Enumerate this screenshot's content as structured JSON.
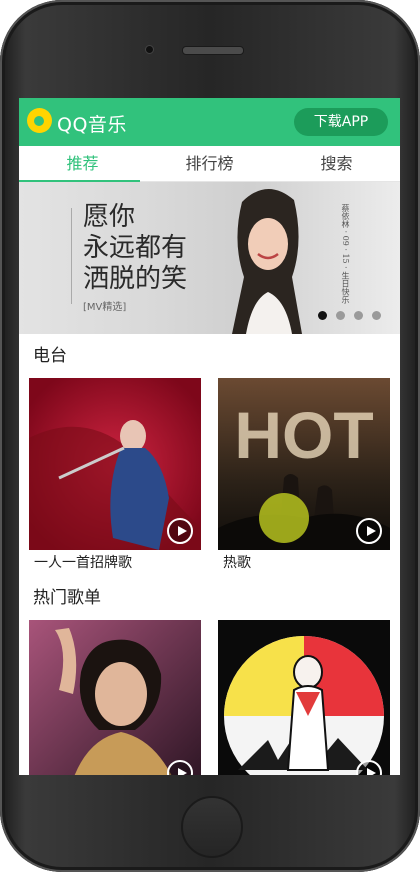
{
  "app": {
    "brand": "QQ音乐",
    "download_label": "下载APP"
  },
  "tabs": [
    {
      "label": "推荐",
      "active": true
    },
    {
      "label": "排行榜"
    },
    {
      "label": "搜索"
    }
  ],
  "banner": {
    "lines": [
      "愿你",
      "永远都有",
      "洒脱的笑"
    ],
    "tag": "[MV精选]",
    "side_text": "蔡依林 · 09 · 15 · 生日快乐",
    "dots": 4,
    "active_dot": 1
  },
  "sections": [
    {
      "title": "电台",
      "items": [
        {
          "label": "一人一首招牌歌"
        },
        {
          "label": "热歌"
        }
      ]
    },
    {
      "title": "热门歌单",
      "items": [
        {
          "label": ""
        },
        {
          "label": ""
        }
      ]
    }
  ],
  "colors": {
    "accent": "#31c27c",
    "button": "#1c9c5a"
  }
}
